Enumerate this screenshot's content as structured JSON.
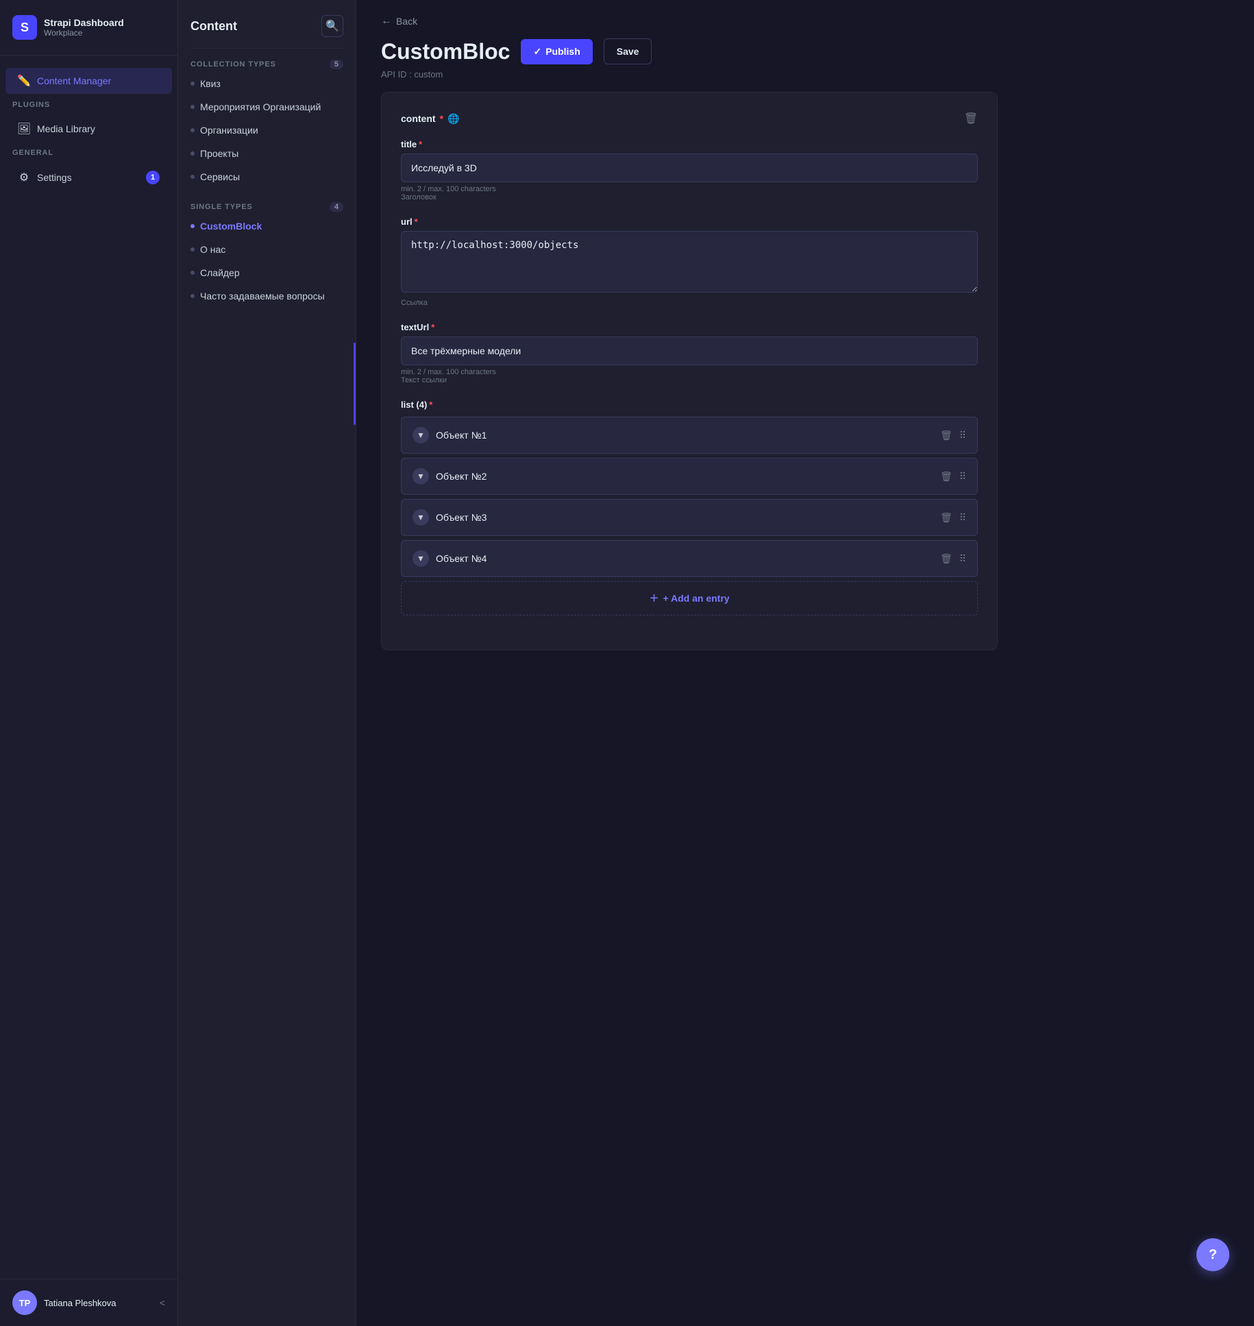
{
  "sidebar": {
    "app_name": "Strapi Dashboard",
    "app_sub": "Workplace",
    "logo_text": "S",
    "sections": [
      {
        "label": "",
        "items": [
          {
            "id": "content-manager",
            "label": "Content Manager",
            "icon": "✏️",
            "active": true,
            "badge": null
          }
        ]
      },
      {
        "label": "PLUGINS",
        "items": [
          {
            "id": "media-library",
            "label": "Media Library",
            "icon": "🖼",
            "active": false,
            "badge": null
          }
        ]
      },
      {
        "label": "GENERAL",
        "items": [
          {
            "id": "settings",
            "label": "Settings",
            "icon": "⚙",
            "active": false,
            "badge": "1"
          }
        ]
      }
    ],
    "user": {
      "initials": "TP",
      "name": "Tatiana Pleshkova"
    },
    "collapse_label": "<"
  },
  "content_panel": {
    "title": "Content",
    "collection_types_label": "COLLECTION TYPES",
    "collection_types_count": "5",
    "collection_types": [
      {
        "label": "Квиз"
      },
      {
        "label": "Мероприятия Организаций"
      },
      {
        "label": "Организации"
      },
      {
        "label": "Проекты"
      },
      {
        "label": "Сервисы"
      }
    ],
    "single_types_label": "SINGLE TYPES",
    "single_types_count": "4",
    "single_types": [
      {
        "label": "CustomBlock",
        "active": true
      },
      {
        "label": "О нас"
      },
      {
        "label": "Слайдер"
      },
      {
        "label": "Часто задаваемые вопросы"
      }
    ]
  },
  "main": {
    "back_label": "Back",
    "page_title": "CustomBloc",
    "api_id_label": "API ID : custom",
    "publish_label": "Publish",
    "save_label": "Save",
    "form": {
      "section_label": "content",
      "title_field": {
        "label": "title",
        "value": "Исследуй в 3D",
        "hint_line1": "min. 2 / max. 100 characters",
        "hint_line2": "Заголовок"
      },
      "url_field": {
        "label": "url",
        "value": "http://localhost:3000/objects",
        "hint": "Ссылка"
      },
      "textUrl_field": {
        "label": "textUrl",
        "value": "Все трёхмерные модели",
        "hint_line1": "min. 2 / max. 100 characters",
        "hint_line2": "Текст ссылки"
      },
      "list_label": "list (4)",
      "list_items": [
        {
          "label": "Объект №1"
        },
        {
          "label": "Объект №2"
        },
        {
          "label": "Объект №3"
        },
        {
          "label": "Объект №4"
        }
      ],
      "add_entry_label": "+ Add an entry"
    }
  },
  "help_bubble_label": "?"
}
